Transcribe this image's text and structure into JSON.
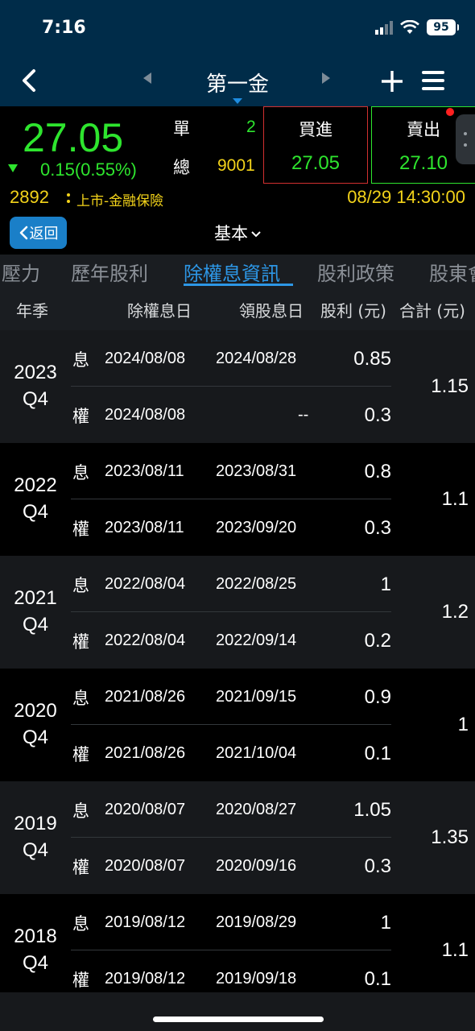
{
  "status_bar": {
    "time": "7:16",
    "battery": "95"
  },
  "nav": {
    "title": "第一金"
  },
  "quote": {
    "price": "27.05",
    "change": "0.15(0.55%)",
    "single_label": "單",
    "single_volume": "2",
    "total_label": "總",
    "total_volume": "9001",
    "buy_label": "買進",
    "buy_price": "27.05",
    "sell_label": "賣出",
    "sell_price": "27.10",
    "stock_code": "2892",
    "market": "上市-金融保險",
    "datetime": "08/29 14:30:00",
    "colors": {
      "up_down": "#2ee52e",
      "info": "#f3d31a",
      "buy_border": "#d23030",
      "sell_border": "#2ee52e"
    }
  },
  "toolbar": {
    "return_label": "返回",
    "section_label": "基本"
  },
  "tabs": [
    "壓力",
    "歷年股利",
    "除權息資訊",
    "股利政策",
    "股東會"
  ],
  "active_tab": "除權息資訊",
  "columns": [
    "年季",
    "除權息日",
    "領股息日",
    "股利 (元)",
    "合計 (元)"
  ],
  "groups": [
    {
      "year": "2023",
      "quarter": "Q4",
      "total": "1.15",
      "rows": [
        {
          "type": "息",
          "ex_date": "2024/08/08",
          "pay_date": "2024/08/28",
          "amount": "0.85"
        },
        {
          "type": "權",
          "ex_date": "2024/08/08",
          "pay_date": "--",
          "amount": "0.3"
        }
      ]
    },
    {
      "year": "2022",
      "quarter": "Q4",
      "total": "1.1",
      "rows": [
        {
          "type": "息",
          "ex_date": "2023/08/11",
          "pay_date": "2023/08/31",
          "amount": "0.8"
        },
        {
          "type": "權",
          "ex_date": "2023/08/11",
          "pay_date": "2023/09/20",
          "amount": "0.3"
        }
      ]
    },
    {
      "year": "2021",
      "quarter": "Q4",
      "total": "1.2",
      "rows": [
        {
          "type": "息",
          "ex_date": "2022/08/04",
          "pay_date": "2022/08/25",
          "amount": "1"
        },
        {
          "type": "權",
          "ex_date": "2022/08/04",
          "pay_date": "2022/09/14",
          "amount": "0.2"
        }
      ]
    },
    {
      "year": "2020",
      "quarter": "Q4",
      "total": "1",
      "rows": [
        {
          "type": "息",
          "ex_date": "2021/08/26",
          "pay_date": "2021/09/15",
          "amount": "0.9"
        },
        {
          "type": "權",
          "ex_date": "2021/08/26",
          "pay_date": "2021/10/04",
          "amount": "0.1"
        }
      ]
    },
    {
      "year": "2019",
      "quarter": "Q4",
      "total": "1.35",
      "rows": [
        {
          "type": "息",
          "ex_date": "2020/08/07",
          "pay_date": "2020/08/27",
          "amount": "1.05"
        },
        {
          "type": "權",
          "ex_date": "2020/08/07",
          "pay_date": "2020/09/16",
          "amount": "0.3"
        }
      ]
    },
    {
      "year": "2018",
      "quarter": "Q4",
      "total": "1.1",
      "rows": [
        {
          "type": "息",
          "ex_date": "2019/08/12",
          "pay_date": "2019/08/29",
          "amount": "1"
        },
        {
          "type": "權",
          "ex_date": "2019/08/12",
          "pay_date": "2019/09/18",
          "amount": "0.1"
        }
      ]
    }
  ]
}
